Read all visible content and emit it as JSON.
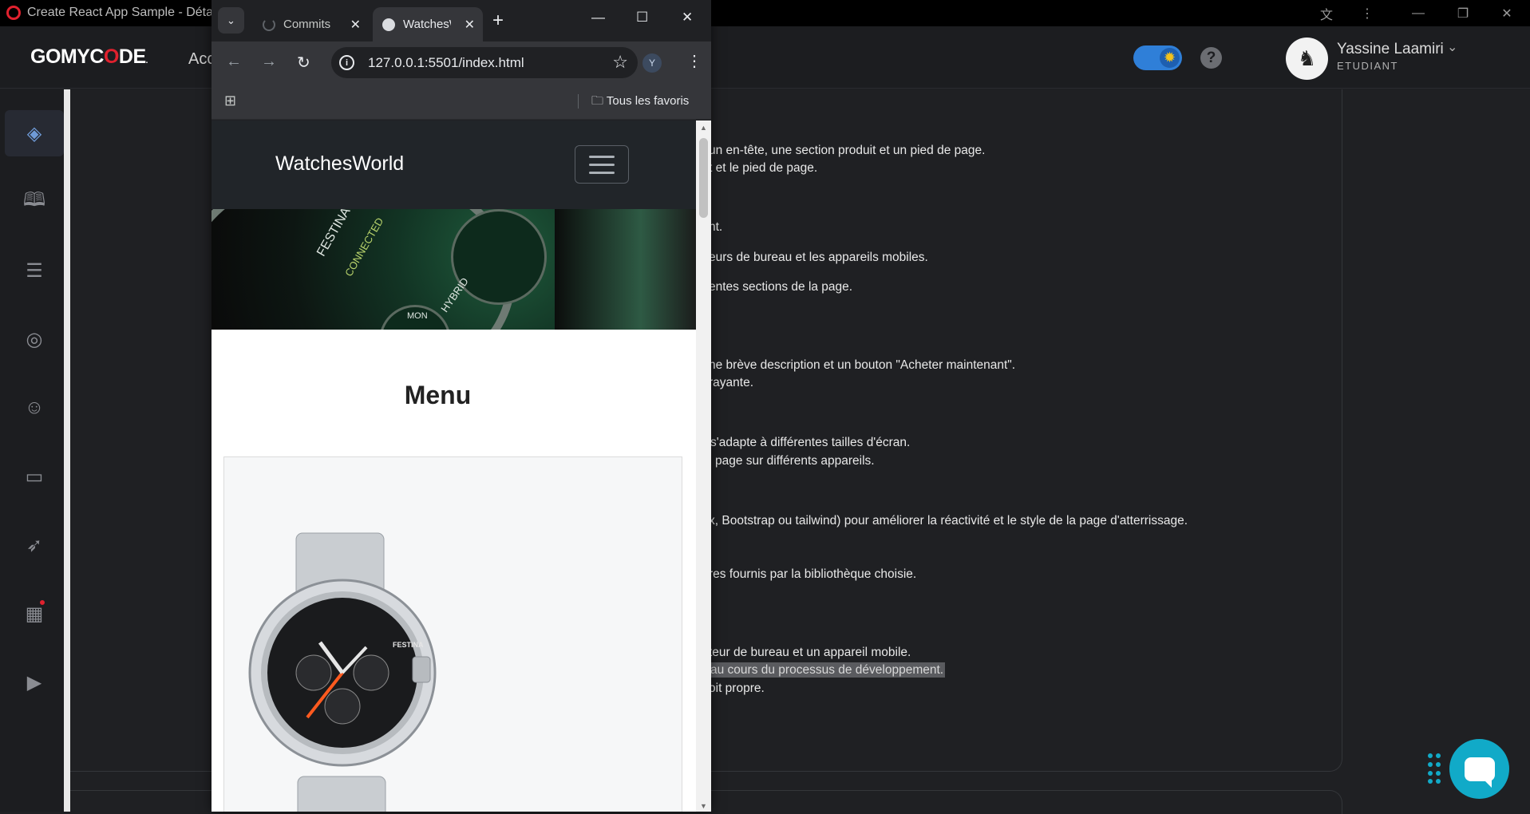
{
  "window": {
    "title": "Create React App Sample - Détails",
    "controls": [
      "translate-icon",
      "kebab-icon",
      "minimize-icon",
      "restore-icon",
      "close-icon"
    ]
  },
  "header": {
    "logo": {
      "pre": "GOMYC",
      "o": "O",
      "post": "DE",
      "mark": "."
    },
    "nav_partial": "Acc",
    "theme_toggle": {
      "state": "on",
      "icon": "sun-icon"
    },
    "help_label": "?",
    "user": {
      "name": "Yassine Laamiri",
      "role": "ETUDIANT"
    }
  },
  "sidebar": {
    "items": [
      {
        "icon": "layers-icon",
        "active": true
      },
      {
        "icon": "book-icon"
      },
      {
        "icon": "bookmark-icon"
      },
      {
        "icon": "target-icon"
      },
      {
        "icon": "users-icon"
      },
      {
        "icon": "laptop-icon"
      },
      {
        "icon": "rocket-icon"
      },
      {
        "icon": "calendar-icon",
        "badge": true
      },
      {
        "icon": "video-icon"
      }
    ]
  },
  "content": {
    "lines": [
      "un en-tête, une section produit et un pied de page.",
      "t et le pied de page.",
      "nt.",
      "eurs de bureau et les appareils mobiles.",
      "entes sections de la page.",
      "ne brève description et un bouton \"Acheter maintenant\".",
      "rayante.",
      "s'adapte à différentes tailles d'écran.",
      "page sur différents appareils.",
      "x, Bootstrap ou tailwind) pour améliorer la réactivité et le style de la page d'atterrissage.",
      "res fournis par la bibliothèque choisie.",
      "teur de bureau et un appareil mobile.",
      "au cours du processus de développement.",
      "oit propre."
    ]
  },
  "browser": {
    "tabs": [
      {
        "title": "Commits",
        "active": false
      },
      {
        "title": "WatchesWorld",
        "active": true
      }
    ],
    "url": "127.0.0.1:5501/index.html",
    "profile_initial": "Y",
    "bookmarks_label": "Tous les favoris"
  },
  "site": {
    "brand": "WatchesWorld",
    "menu_title": "Menu",
    "hero_text": [
      "FESTINA",
      "CONNECTED",
      "HYBRID",
      "MON"
    ],
    "watch_text": "FESTINA"
  }
}
